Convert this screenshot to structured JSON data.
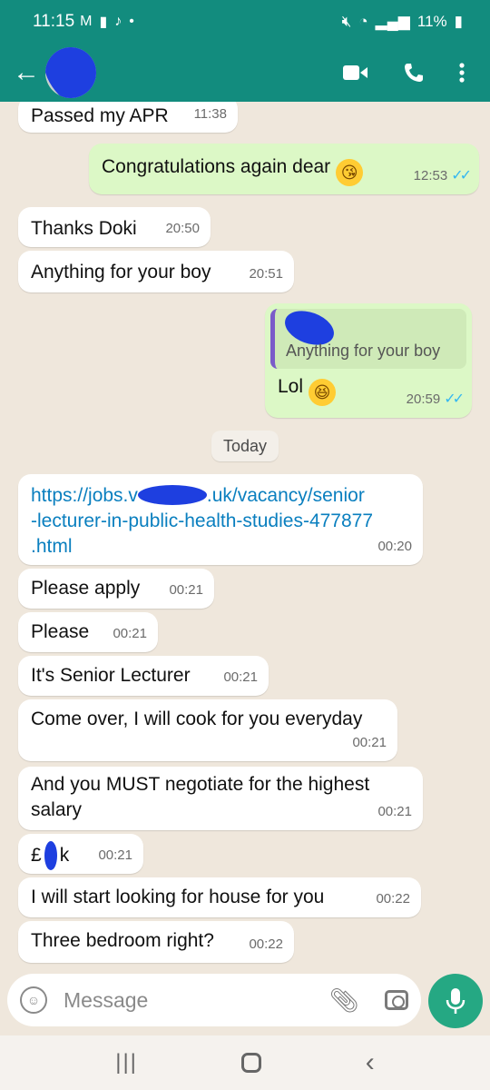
{
  "status_bar": {
    "time": "11:15",
    "left_icons": [
      "gmail-icon",
      "sim-icon",
      "tiktok-icon",
      "dot-icon"
    ],
    "right_icons": [
      "mute-icon",
      "wifi-icon",
      "signal-icon"
    ],
    "battery": "11%"
  },
  "app_bar": {
    "back_icon": "arrow-left-icon",
    "actions": [
      "video-call-icon",
      "voice-call-icon",
      "more-vert-icon"
    ]
  },
  "messages": [
    {
      "dir": "in",
      "text": "Passed my APR",
      "time": "11:38"
    },
    {
      "dir": "out",
      "text": "Congratulations again dear",
      "emoji": "kissing-face",
      "time": "12:53",
      "read": true
    },
    {
      "dir": "in",
      "text": "Thanks Doki",
      "time": "20:50"
    },
    {
      "dir": "in",
      "text": "Anything for your boy",
      "time": "20:51"
    },
    {
      "dir": "out",
      "reply_to": "Anything for your boy",
      "text": "Lol",
      "emoji": "grinning-squinting-face",
      "time": "20:59",
      "read": true
    },
    {
      "dir": "in",
      "link_lines": [
        "https://jobs.v",
        ".uk/vacancy/senior",
        "-lecturer-in-public-health-studies-477877",
        ".html"
      ],
      "time": "00:20"
    },
    {
      "dir": "in",
      "text": "Please apply",
      "time": "00:21"
    },
    {
      "dir": "in",
      "text": "Please",
      "time": "00:21"
    },
    {
      "dir": "in",
      "text": "It's Senior Lecturer",
      "time": "00:21"
    },
    {
      "dir": "in",
      "text": "Come over, I will cook for you everyday",
      "time": "00:21"
    },
    {
      "dir": "in",
      "text_lines": [
        "And you MUST negotiate for the highest",
        "salary"
      ],
      "time": "00:21"
    },
    {
      "dir": "in",
      "text_parts": [
        "£",
        "k"
      ],
      "time": "00:21"
    },
    {
      "dir": "in",
      "text": "I will start looking for house for you",
      "time": "00:22"
    },
    {
      "dir": "in",
      "text": "Three bedroom right?",
      "time": "00:22"
    }
  ],
  "date_separator": "Today",
  "input": {
    "placeholder": "Message",
    "icons": [
      "emoji-icon",
      "attach-icon",
      "camera-icon",
      "mic-icon"
    ]
  },
  "nav_bar": [
    "recent-apps-icon",
    "home-icon",
    "back-icon"
  ],
  "colors": {
    "header": "#128c7e",
    "outgoing_bubble": "#dcf8c6",
    "incoming_bubble": "#ffffff",
    "chat_background": "#efe7dc",
    "read_ticks": "#34b7f1",
    "mic_button": "#25a883"
  }
}
